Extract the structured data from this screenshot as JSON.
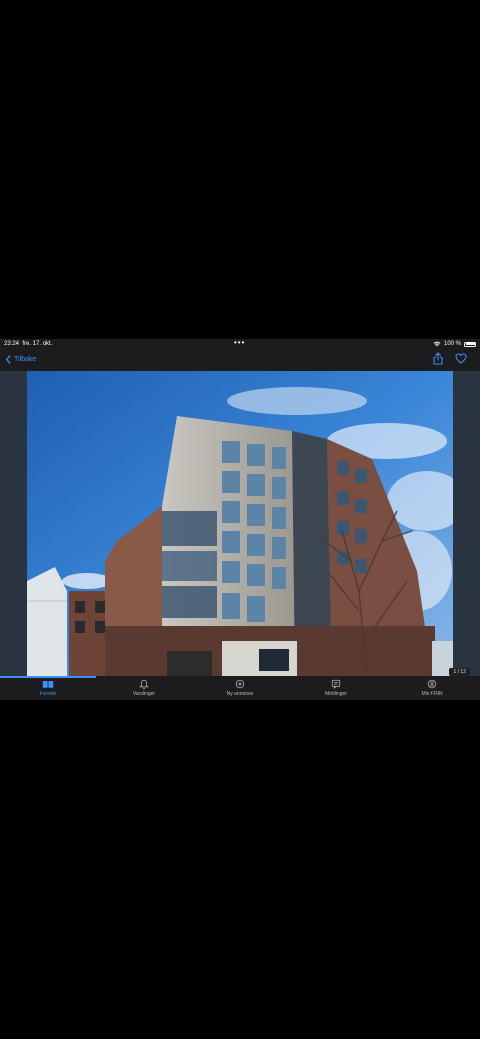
{
  "status": {
    "time": "23:24",
    "date": "fre. 17. okt.",
    "dots": "•••",
    "battery": "100 %"
  },
  "nav": {
    "back_label": "Tilbake"
  },
  "gallery": {
    "counter": "1 / 12"
  },
  "tabs": [
    {
      "label": "Forside",
      "icon": "book-icon",
      "active": true
    },
    {
      "label": "Varslinger",
      "icon": "bell-icon",
      "active": false
    },
    {
      "label": "Ny annonse",
      "icon": "plus-circle-icon",
      "active": false
    },
    {
      "label": "Meldinger",
      "icon": "message-icon",
      "active": false
    },
    {
      "label": "Min FINN",
      "icon": "profile-icon",
      "active": false
    }
  ],
  "colors": {
    "accent": "#3e8ef7",
    "background": "#000000",
    "panel": "#1c1c1e"
  }
}
